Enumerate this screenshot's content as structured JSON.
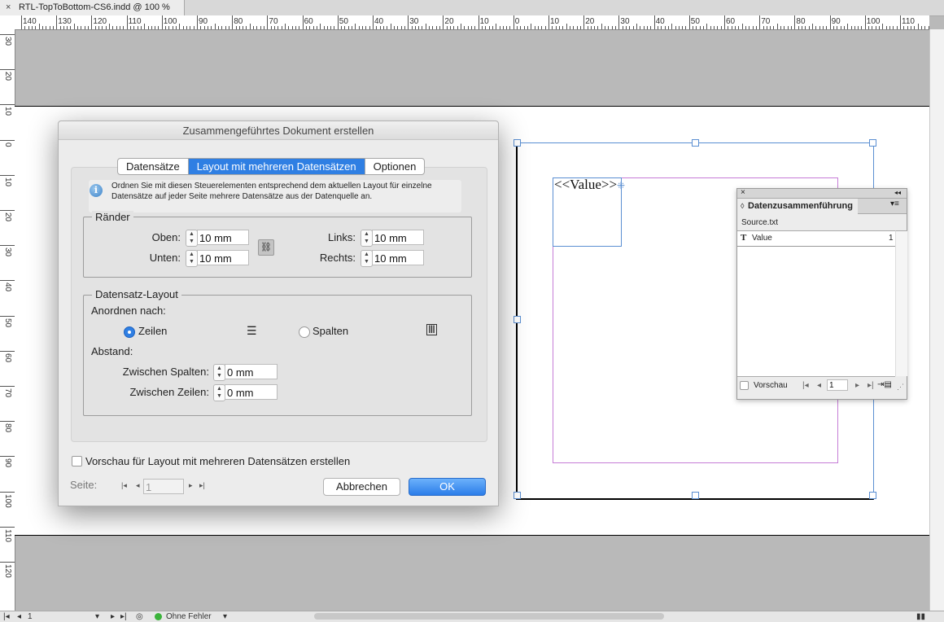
{
  "document_tab": {
    "close": "×",
    "title": "RTL-TopToBottom-CS6.indd @ 100 %"
  },
  "ruler_top_labels": [
    "140",
    "130",
    "120",
    "110",
    "100",
    "90",
    "80",
    "70",
    "60",
    "50",
    "40",
    "30",
    "20",
    "10",
    "0",
    "10",
    "20",
    "30",
    "40",
    "50",
    "60",
    "70",
    "80",
    "90",
    "100",
    "110"
  ],
  "ruler_left_labels": [
    "30",
    "20",
    "10",
    "0",
    "10",
    "20",
    "30",
    "40",
    "50",
    "60",
    "70",
    "80",
    "90",
    "100",
    "110",
    "120"
  ],
  "canvas": {
    "placeholder_text": "<<Value>>",
    "port_glyph": "⁜"
  },
  "panel": {
    "close": "×",
    "collapse": "◂◂",
    "title": "Datenzusammenführung",
    "title_prefix": "◊",
    "menu": "▾≡",
    "source": "Source.txt",
    "fields": [
      {
        "type_icon": "T",
        "name": "Value",
        "value": "1"
      }
    ],
    "footer": {
      "preview_label": "Vorschau",
      "first": "|◂",
      "prev": "◂",
      "record": "1",
      "next": "▸",
      "last": "▸|",
      "create_icon": "⇥▤",
      "resize": "⋰"
    }
  },
  "dialog": {
    "title": "Zusammengeführtes Dokument erstellen",
    "tabs": [
      "Datensätze",
      "Layout mit mehreren Datensätzen",
      "Optionen"
    ],
    "active_tab": 1,
    "info_icon": "i",
    "info_text": "Ordnen Sie mit diesen Steuerelementen entsprechend dem aktuellen Layout für einzelne Datensätze auf jeder Seite mehrere Datensätze aus der Datenquelle an.",
    "margins": {
      "legend": "Ränder",
      "top_label": "Oben:",
      "top_value": "10 mm",
      "bottom_label": "Unten:",
      "bottom_value": "10 mm",
      "left_label": "Links:",
      "left_value": "10 mm",
      "right_label": "Rechts:",
      "right_value": "10 mm",
      "link_icon": "⛓"
    },
    "layout": {
      "legend": "Datensatz-Layout",
      "arrange_label": "Anordnen nach:",
      "rows_label": "Zeilen",
      "rows_icon": "☰",
      "columns_label": "Spalten",
      "columns_icon": "Ⅲ",
      "spacing_label": "Abstand:",
      "between_columns_label": "Zwischen Spalten:",
      "between_columns_value": "0 mm",
      "between_rows_label": "Zwischen Zeilen:",
      "between_rows_value": "0 mm",
      "selected": "Zeilen"
    },
    "preview_checkbox_label": "Vorschau für Layout mit mehreren Datensätzen erstellen",
    "page_label": "Seite:",
    "page_first": "|◂",
    "page_prev": "◂",
    "page_value": "1",
    "page_next": "▸",
    "page_last": "▸|",
    "cancel_label": "Abbrechen",
    "ok_label": "OK"
  },
  "status_bar": {
    "first": "|◂",
    "prev": "◂",
    "page": "1",
    "dropdown": "▾",
    "next": "▸",
    "last": "▸|",
    "preflight_icon": "◎",
    "status": "Ohne Fehler",
    "status_dropdown": "▾",
    "view_icon": "▮▮"
  },
  "colors": {
    "accent": "#2f7fe3",
    "frame": "#5b8fd2",
    "margin_guide": "#c67cd6",
    "status_ok": "#3bb33b"
  }
}
